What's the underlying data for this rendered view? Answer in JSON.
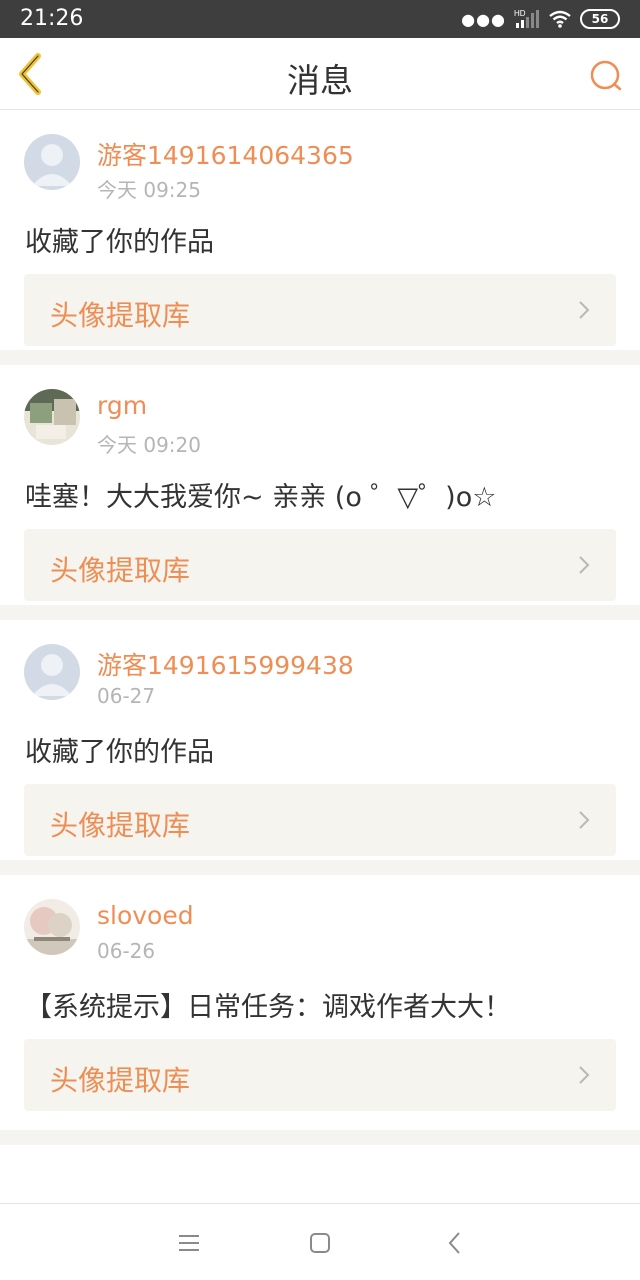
{
  "status_bar": {
    "time": "21:26",
    "signal_label": "HD",
    "battery": "56",
    "icons": [
      "dots-icon",
      "signal-icon",
      "wifi-icon",
      "battery-icon"
    ]
  },
  "header": {
    "title": "消息",
    "back_icon": "chevron-left-icon",
    "search_icon": "search-icon",
    "accent_color": "#ee8e55",
    "back_color": "#f2c233"
  },
  "messages": [
    {
      "username": "游客1491614064365",
      "time": "今天 09:25",
      "text": "收藏了你的作品",
      "work_title": "头像提取库",
      "avatar": "default-avatar"
    },
    {
      "username": "rgm",
      "time": "今天 09:20",
      "text": "哇塞！大大我爱你~ 亲亲 (o ゜▽゜)o☆",
      "work_title": "头像提取库",
      "avatar": "photo-avatar"
    },
    {
      "username": "游客1491615999438",
      "time": "06-27",
      "text": "收藏了你的作品",
      "work_title": "头像提取库",
      "avatar": "default-avatar"
    },
    {
      "username": "slovoed",
      "time": "06-26",
      "text": "【系统提示】日常任务：调戏作者大大！",
      "work_title": "头像提取库",
      "avatar": "photo-avatar"
    }
  ],
  "nav_bar": {
    "buttons": [
      "menu-icon",
      "home-square-icon",
      "back-icon"
    ]
  }
}
